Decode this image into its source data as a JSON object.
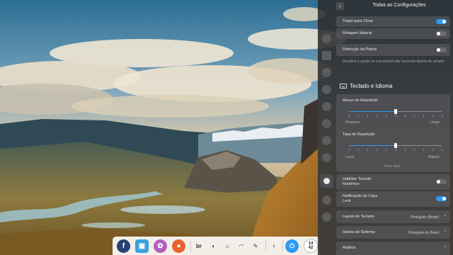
{
  "colors": {
    "accent": "#2b9bf4",
    "panel_bg": "#2c2c2e"
  },
  "dock": {
    "apps": [
      {
        "name": "fedora-icon",
        "glyph": "f",
        "color": "#294172"
      },
      {
        "name": "files-icon",
        "glyph": "▣",
        "color": "#3aa0e0"
      },
      {
        "name": "settings-icon",
        "glyph": "✿",
        "color": "#b25fc0"
      },
      {
        "name": "firefox-icon",
        "glyph": "●",
        "color": "#e8632b"
      },
      {
        "name": "keyboard-layout-icon",
        "glyph": "br",
        "color": "#333333"
      },
      {
        "name": "volume-tray-icon",
        "glyph": "◖",
        "color": "#333333"
      },
      {
        "name": "brightness-tray-icon",
        "glyph": "☼",
        "color": "#333333"
      },
      {
        "name": "wifi-tray-icon",
        "glyph": "◠",
        "color": "#333333"
      },
      {
        "name": "edit-tray-icon",
        "glyph": "✎",
        "color": "#333333"
      }
    ],
    "chevron": "‹",
    "clock": {
      "line1": "14",
      "line2": "42"
    }
  },
  "panel": {
    "title": "Todas as Configurações",
    "rows": {
      "tap_to_click": {
        "label": "Toque para Clicar",
        "on": true
      },
      "natural_scroll": {
        "label": "Rolagem Natural",
        "on": false
      },
      "palm_detection": {
        "label": "Detecção da Palma",
        "on": false
      }
    },
    "palm_hint": "Desative a opção se o touchpad não funcionar depois de ativado",
    "section_title": "Teclado e Idioma",
    "repeat_delay": {
      "label": "Atraso de Repetição",
      "min_label": "Pequeno",
      "max_label": "Longo",
      "value": 0.5
    },
    "repeat_rate": {
      "label": "Taxa de Repetição",
      "min_label": "Lento",
      "max_label": "Rápido",
      "value": 0.5
    },
    "test_placeholder": "Teste Aqui",
    "numlock": {
      "label_line1": "Habilitar Teclado",
      "label_line2": "Numérico",
      "on": false
    },
    "capslock": {
      "label_line1": "Notificação do Caps",
      "label_line2": "Lock",
      "on": true
    },
    "keyboard_layout": {
      "label": "Layout do Teclado",
      "value": "Português (Brasil)"
    },
    "system_language": {
      "label": "Idioma do Sistema",
      "value": "Português do Brasil"
    },
    "shortcuts": {
      "label": "Atalhos"
    }
  }
}
